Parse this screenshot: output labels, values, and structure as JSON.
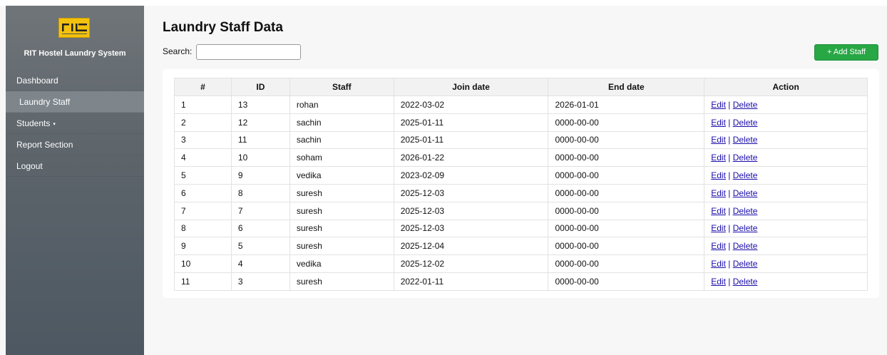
{
  "sidebar": {
    "logo_icon": "rit-logo",
    "brand": "RIT Hostel Laundry System",
    "items": [
      {
        "label": "Dashboard"
      },
      {
        "label": "Laundry Staff"
      },
      {
        "label": "Students",
        "caret": "▾"
      },
      {
        "label": "Report Section"
      },
      {
        "label": "Logout"
      }
    ]
  },
  "main": {
    "title": "Laundry Staff Data",
    "search_label": "Search:",
    "search_value": "",
    "add_button": "+ Add Staff"
  },
  "table": {
    "headers": [
      "#",
      "ID",
      "Staff",
      "Join date",
      "End date",
      "Action"
    ],
    "edit_label": "Edit",
    "separator": " | ",
    "delete_label": "Delete",
    "rows": [
      {
        "n": "1",
        "id": "13",
        "staff": "rohan",
        "join": "2022-03-02",
        "end": "2026-01-01"
      },
      {
        "n": "2",
        "id": "12",
        "staff": "sachin",
        "join": "2025-01-11",
        "end": "0000-00-00"
      },
      {
        "n": "3",
        "id": "11",
        "staff": "sachin",
        "join": "2025-01-11",
        "end": "0000-00-00"
      },
      {
        "n": "4",
        "id": "10",
        "staff": "soham",
        "join": "2026-01-22",
        "end": "0000-00-00"
      },
      {
        "n": "5",
        "id": "9",
        "staff": "vedika",
        "join": "2023-02-09",
        "end": "0000-00-00"
      },
      {
        "n": "6",
        "id": "8",
        "staff": "suresh",
        "join": "2025-12-03",
        "end": "0000-00-00"
      },
      {
        "n": "7",
        "id": "7",
        "staff": "suresh",
        "join": "2025-12-03",
        "end": "0000-00-00"
      },
      {
        "n": "8",
        "id": "6",
        "staff": "suresh",
        "join": "2025-12-03",
        "end": "0000-00-00"
      },
      {
        "n": "9",
        "id": "5",
        "staff": "suresh",
        "join": "2025-12-04",
        "end": "0000-00-00"
      },
      {
        "n": "10",
        "id": "4",
        "staff": "vedika",
        "join": "2025-12-02",
        "end": "0000-00-00"
      },
      {
        "n": "11",
        "id": "3",
        "staff": "suresh",
        "join": "2022-01-11",
        "end": "0000-00-00"
      }
    ]
  },
  "colors": {
    "accent_green": "#28a745",
    "link_blue": "#1a0dab",
    "logo_yellow": "#f4c20d"
  }
}
